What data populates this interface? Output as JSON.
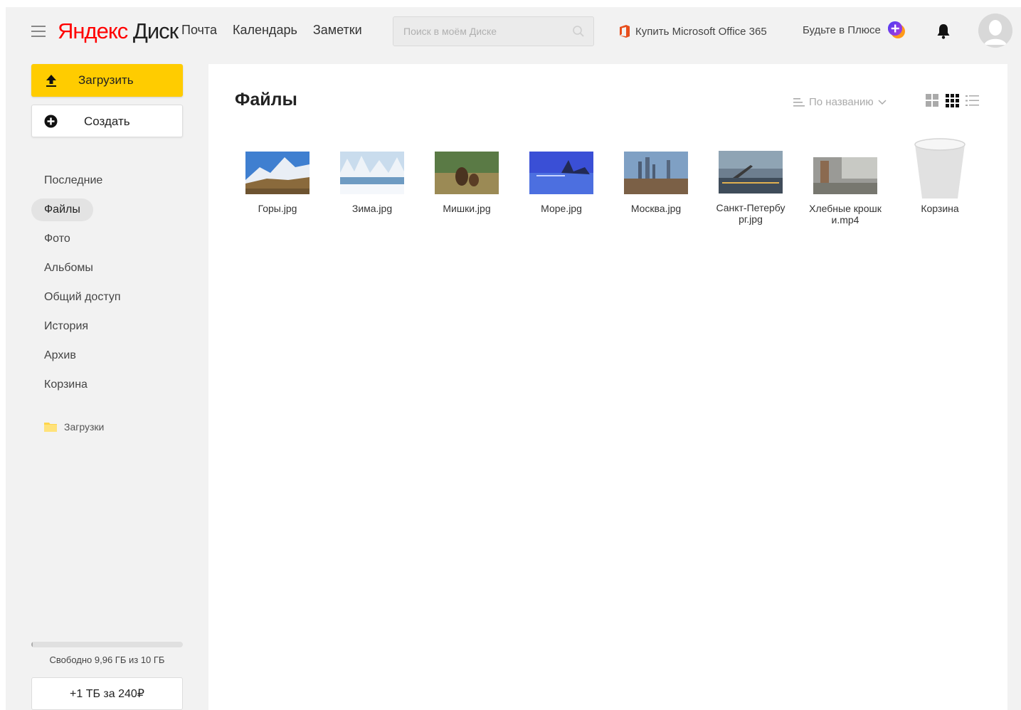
{
  "header": {
    "logo_ya": "Яндекс",
    "logo_disk": "Диск",
    "nav": [
      "Почта",
      "Календарь",
      "Заметки"
    ],
    "search_placeholder": "Поиск в моём Диске",
    "office_label": "Купить Microsoft Office 365",
    "plus_label": "Будьте в Плюсе"
  },
  "sidebar": {
    "upload_label": "Загрузить",
    "create_label": "Создать",
    "items": [
      "Последние",
      "Файлы",
      "Фото",
      "Альбомы",
      "Общий доступ",
      "История",
      "Архив",
      "Корзина"
    ],
    "active_item": "Файлы",
    "folder_label": "Загрузки",
    "storage_text": "Свободно 9,96 ГБ из 10 ГБ",
    "storage_used_fraction": 0.004,
    "buy_label": "+1 ТБ за 240₽"
  },
  "main": {
    "title": "Файлы",
    "sort_label": "По названию",
    "files": [
      {
        "name": "Горы.jpg",
        "kind": "mountains"
      },
      {
        "name": "Зима.jpg",
        "kind": "winter"
      },
      {
        "name": "Мишки.jpg",
        "kind": "bears"
      },
      {
        "name": "Море.jpg",
        "kind": "sea"
      },
      {
        "name": "Москва.jpg",
        "kind": "moscow"
      },
      {
        "name": "Санкт-Петербург.jpg",
        "kind": "spb"
      },
      {
        "name": "Хлебные крошки.mp4",
        "kind": "video"
      },
      {
        "name": "Корзина",
        "kind": "trash"
      }
    ]
  },
  "colors": {
    "accent_yellow": "#ffcc00",
    "logo_red": "#ff0000",
    "office_orange": "#e74e1c",
    "plus_blue": "#3b3bf0"
  }
}
